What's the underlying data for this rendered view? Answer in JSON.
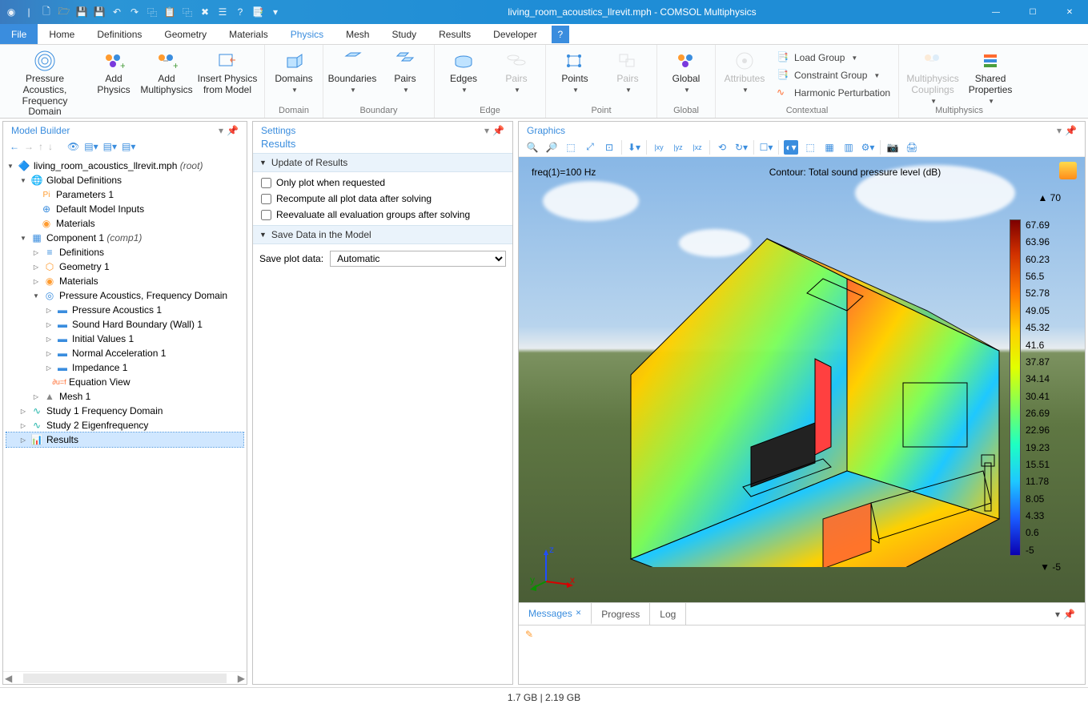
{
  "window": {
    "title": "living_room_acoustics_llrevit.mph - COMSOL Multiphysics"
  },
  "menu": {
    "file": "File",
    "items": [
      "Home",
      "Definitions",
      "Geometry",
      "Materials",
      "Physics",
      "Mesh",
      "Study",
      "Results",
      "Developer"
    ],
    "help": "?"
  },
  "ribbon": {
    "physics": {
      "items": {
        "pressure": "Pressure Acoustics,\nFrequency Domain",
        "add_physics": "Add\nPhysics",
        "add_multi": "Add\nMultiphysics",
        "insert": "Insert Physics\nfrom Model"
      },
      "label": "Physics"
    },
    "domain": {
      "domains": "Domains",
      "label": "Domain"
    },
    "boundary": {
      "boundaries": "Boundaries",
      "pairs": "Pairs",
      "label": "Boundary"
    },
    "edge": {
      "edges": "Edges",
      "pairs": "Pairs",
      "label": "Edge"
    },
    "point": {
      "points": "Points",
      "pairs": "Pairs",
      "label": "Point"
    },
    "global": {
      "global": "Global",
      "label": "Global"
    },
    "contextual": {
      "attributes": "Attributes",
      "load_group": "Load Group",
      "constraint_group": "Constraint Group",
      "harmonic": "Harmonic Perturbation",
      "label": "Contextual"
    },
    "multiphysics": {
      "couplings": "Multiphysics\nCouplings",
      "shared": "Shared\nProperties",
      "label": "Multiphysics"
    }
  },
  "model_builder": {
    "title": "Model Builder",
    "root": "living_room_acoustics_llrevit.mph",
    "root_suffix": "(root)",
    "global": "Global Definitions",
    "param": "Parameters 1",
    "dmi": "Default Model Inputs",
    "materials": "Materials",
    "component": "Component 1",
    "component_suffix": "(comp1)",
    "definitions": "Definitions",
    "geometry": "Geometry 1",
    "materials2": "Materials",
    "pafd": "Pressure Acoustics, Frequency Domain",
    "pa1": "Pressure Acoustics 1",
    "shb": "Sound Hard Boundary (Wall) 1",
    "iv": "Initial Values 1",
    "na": "Normal Acceleration 1",
    "imp": "Impedance 1",
    "eqv": "Equation View",
    "mesh": "Mesh 1",
    "study1": "Study 1 Frequency Domain",
    "study2": "Study 2 Eigenfrequency",
    "results": "Results"
  },
  "settings": {
    "title": "Settings",
    "subtitle": "Results",
    "section1": "Update of Results",
    "cb1": "Only plot when requested",
    "cb2": "Recompute all plot data after solving",
    "cb3": "Reevaluate all evaluation groups after solving",
    "section2": "Save Data in the Model",
    "save_label": "Save plot data:",
    "save_option": "Automatic"
  },
  "graphics": {
    "title": "Graphics",
    "freq_label": "freq(1)=100 Hz",
    "plot_title": "Contour: Total sound pressure level (dB)",
    "legend_top": "▲ 70",
    "legend_bottom": "▼ -5",
    "legend_ticks": [
      "67.69",
      "63.96",
      "60.23",
      "56.5",
      "52.78",
      "49.05",
      "45.32",
      "41.6",
      "37.87",
      "34.14",
      "30.41",
      "26.69",
      "22.96",
      "19.23",
      "15.51",
      "11.78",
      "8.05",
      "4.33",
      "0.6",
      "-5"
    ],
    "triad": {
      "x": "x",
      "y": "y",
      "z": "z"
    }
  },
  "bottom_tabs": {
    "messages": "Messages",
    "progress": "Progress",
    "log": "Log"
  },
  "status": {
    "mem": "1.7 GB | 2.19 GB"
  }
}
